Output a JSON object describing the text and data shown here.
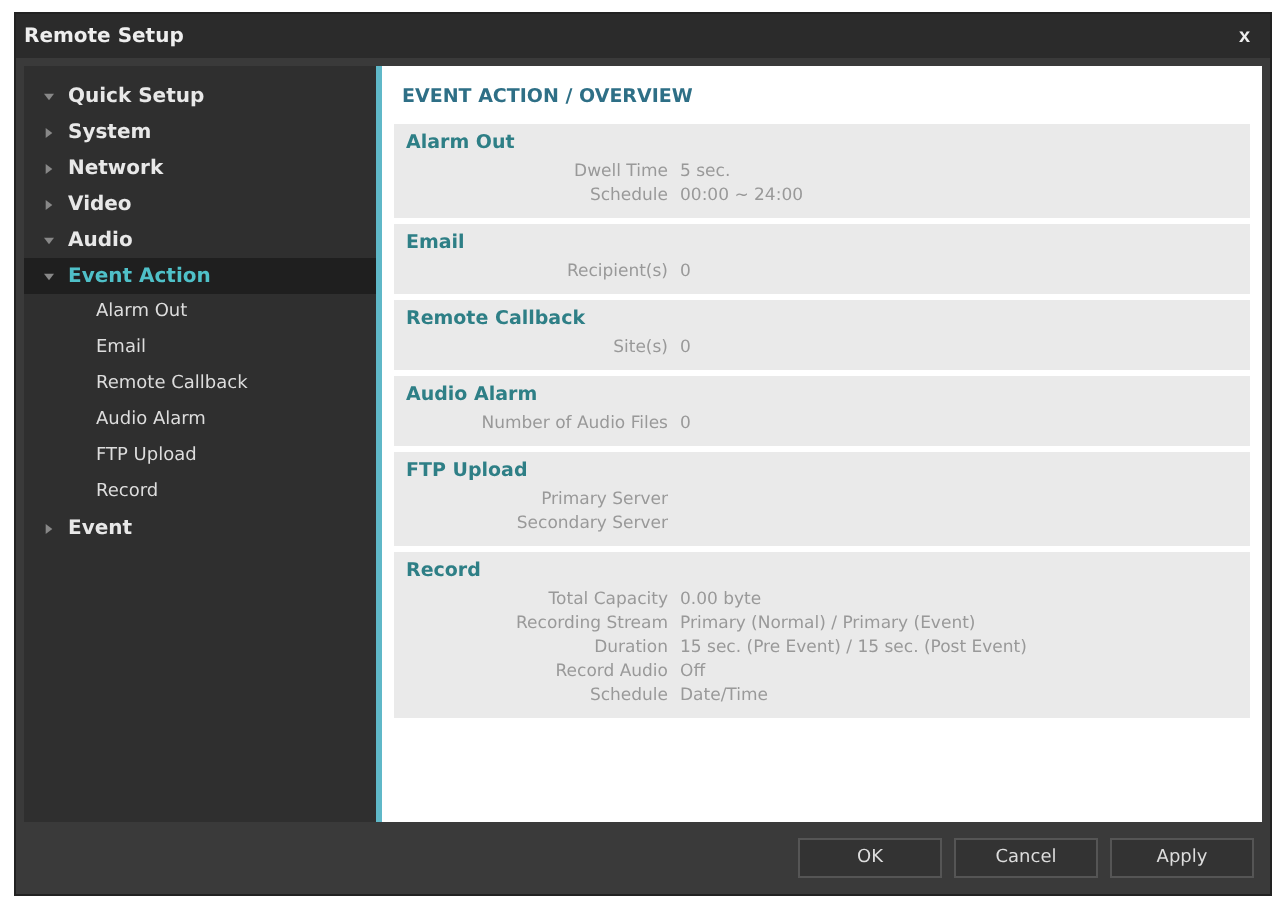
{
  "window": {
    "title": "Remote Setup",
    "close": "x"
  },
  "sidebar": {
    "items": [
      {
        "label": "Quick Setup",
        "expanded": true,
        "selected": false
      },
      {
        "label": "System",
        "expanded": false,
        "selected": false
      },
      {
        "label": "Network",
        "expanded": false,
        "selected": false
      },
      {
        "label": "Video",
        "expanded": false,
        "selected": false
      },
      {
        "label": "Audio",
        "expanded": true,
        "selected": false
      },
      {
        "label": "Event Action",
        "expanded": true,
        "selected": true,
        "children": [
          {
            "label": "Alarm Out"
          },
          {
            "label": "Email"
          },
          {
            "label": "Remote Callback"
          },
          {
            "label": "Audio Alarm"
          },
          {
            "label": "FTP Upload"
          },
          {
            "label": "Record"
          }
        ]
      },
      {
        "label": "Event",
        "expanded": false,
        "selected": false
      }
    ]
  },
  "content": {
    "heading": "EVENT ACTION / OVERVIEW",
    "sections": [
      {
        "title": "Alarm Out",
        "rows": [
          {
            "label": "Dwell Time",
            "value": "5 sec."
          },
          {
            "label": "Schedule",
            "value": "00:00 ~ 24:00"
          }
        ]
      },
      {
        "title": "Email",
        "rows": [
          {
            "label": "Recipient(s)",
            "value": "0"
          }
        ]
      },
      {
        "title": "Remote Callback",
        "rows": [
          {
            "label": "Site(s)",
            "value": "0"
          }
        ]
      },
      {
        "title": "Audio Alarm",
        "rows": [
          {
            "label": "Number of Audio Files",
            "value": "0"
          }
        ]
      },
      {
        "title": "FTP Upload",
        "rows": [
          {
            "label": "Primary Server"
          },
          {
            "label": "Secondary Server"
          }
        ]
      },
      {
        "title": "Record",
        "rows": [
          {
            "label": "Total Capacity",
            "value": "0.00 byte"
          },
          {
            "label": "Recording Stream",
            "value": "Primary (Normal) / Primary (Event)"
          },
          {
            "label": "Duration",
            "value": "15 sec. (Pre Event) / 15 sec. (Post Event)"
          },
          {
            "label": "Record Audio",
            "value": "Off"
          },
          {
            "label": "Schedule",
            "value": "Date/Time"
          }
        ]
      }
    ]
  },
  "buttons": [
    "OK",
    "Cancel",
    "Apply"
  ]
}
